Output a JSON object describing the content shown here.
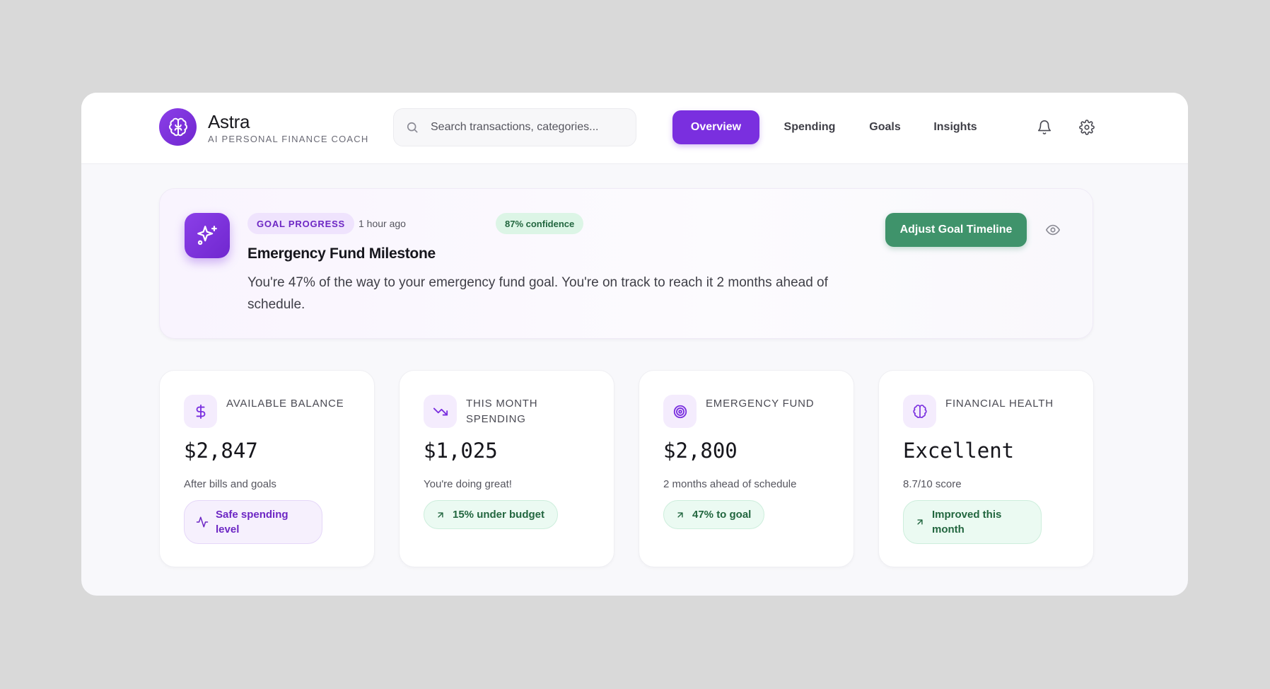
{
  "app": {
    "name": "Astra",
    "subtitle": "AI PERSONAL FINANCE COACH"
  },
  "search": {
    "placeholder": "Search transactions, categories...",
    "value": ""
  },
  "nav": {
    "tabs": [
      {
        "label": "Overview",
        "active": true
      },
      {
        "label": "Spending",
        "active": false
      },
      {
        "label": "Goals",
        "active": false
      },
      {
        "label": "Insights",
        "active": false
      }
    ],
    "icons": [
      "bell-icon",
      "gear-icon"
    ]
  },
  "insight": {
    "icon": "sparkles-icon",
    "category": "GOAL PROGRESS",
    "time": "1 hour ago",
    "confidence": "87% confidence",
    "title": "Emergency Fund Milestone",
    "body": "You're 47% of the way to your emergency fund goal. You're on track to reach it 2 months ahead of schedule.",
    "action_label": "Adjust Goal Timeline",
    "secondary_icon": "eye-icon"
  },
  "stats": [
    {
      "icon": "dollar-icon",
      "label": "AVAILABLE BALANCE",
      "value": "$2,847",
      "sub": "After bills and goals",
      "pill": "Safe spending level",
      "pill_icon": "activity-icon",
      "pill_tone": "purple"
    },
    {
      "icon": "trending-down-icon",
      "label": "THIS MONTH SPENDING",
      "value": "$1,025",
      "sub": "You're doing great!",
      "pill": "15% under budget",
      "pill_icon": "arrow-up-right-icon",
      "pill_tone": "green"
    },
    {
      "icon": "target-icon",
      "label": "EMERGENCY FUND",
      "value": "$2,800",
      "sub": "2 months ahead of schedule",
      "pill": "47% to goal",
      "pill_icon": "arrow-up-right-icon",
      "pill_tone": "green"
    },
    {
      "icon": "brain-icon",
      "label": "FINANCIAL HEALTH",
      "value": "Excellent",
      "sub": "8.7/10 score",
      "pill": "Improved this month",
      "pill_icon": "arrow-up-right-icon",
      "pill_tone": "green"
    }
  ],
  "colors": {
    "accent": "#7a2fdf",
    "success": "#3f936b",
    "background": "#f8f8fb",
    "outer": "#d9d9d9"
  }
}
